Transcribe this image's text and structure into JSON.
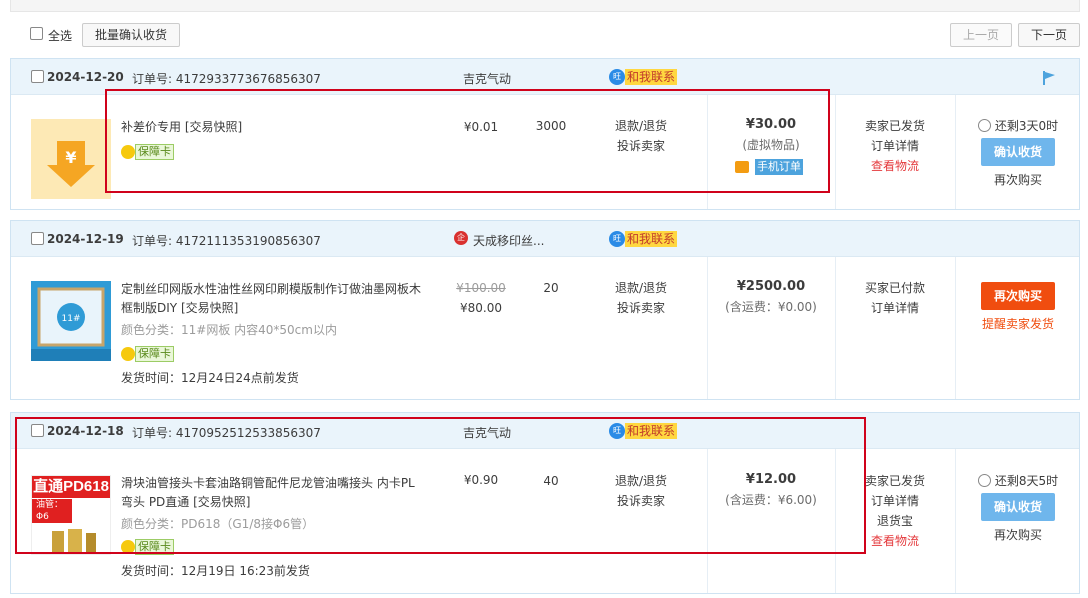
{
  "toolbar": {
    "select_all": "全选",
    "batch_confirm": "批量确认收货",
    "prev_page": "上一页",
    "next_page": "下一页"
  },
  "orders": [
    {
      "date": "2024-12-20",
      "order_no_label": "订单号: 4172933773676856307",
      "shop": "吉克气动",
      "contact": "和我联系",
      "item": {
        "name": "补差价专用",
        "snapshot": "[交易快照]",
        "guarantee": "保障卡",
        "price": "¥0.01",
        "qty": "3000",
        "service_refund": "退款/退货",
        "service_complain": "投诉卖家"
      },
      "total": "¥30.00",
      "total_sub": "(虚拟物品)",
      "mobile_tag": "手机订单",
      "status": [
        "卖家已发货",
        "订单详情",
        "查看物流"
      ],
      "timer": "还剩3天0时",
      "primary_action": "确认收货",
      "secondary_action": "再次购买"
    },
    {
      "date": "2024-12-19",
      "order_no_label": "订单号: 4172111353190856307",
      "shop": "天成移印丝...",
      "contact": "和我联系",
      "item": {
        "name": "定制丝印网版水性油性丝网印刷模版制作订做油墨网板木框制版DIY",
        "snapshot": "[交易快照]",
        "sku": "颜色分类：11#网板 内容40*50cm以内",
        "guarantee": "保障卡",
        "ship_time": "发货时间：12月24日24点前发货",
        "price_old": "¥100.00",
        "price": "¥80.00",
        "qty": "20",
        "service_refund": "退款/退货",
        "service_complain": "投诉卖家"
      },
      "total": "¥2500.00",
      "total_sub": "(含运费：¥0.00)",
      "status": [
        "买家已付款",
        "订单详情"
      ],
      "primary_action": "再次购买",
      "secondary_action": "提醒卖家发货"
    },
    {
      "date": "2024-12-18",
      "order_no_label": "订单号: 4170952512533856307",
      "shop": "吉克气动",
      "contact": "和我联系",
      "item": {
        "name": "滑块油管接头卡套油路铜管配件尼龙管油嘴接头 内卡PL弯头 PD直通",
        "snapshot": "[交易快照]",
        "sku": "颜色分类：PD618（G1/8接Φ6管）",
        "guarantee": "保障卡",
        "ship_time": "发货时间：12月19日 16:23前发货",
        "price": "¥0.90",
        "qty": "40",
        "service_refund": "退款/退货",
        "service_complain": "投诉卖家",
        "thumb_text": "直通PD618",
        "thumb_sub": "油管：Φ6"
      },
      "total": "¥12.00",
      "total_sub": "(含运费：¥6.00)",
      "status": [
        "卖家已发货",
        "订单详情",
        "退货宝",
        "查看物流"
      ],
      "timer": "还剩8天5时",
      "primary_action": "确认收货",
      "secondary_action": "再次购买"
    }
  ],
  "colors": {
    "header_bg": "#eaf4fb",
    "confirm_blue": "#6fb6ec",
    "rebuy_orange": "#f04d0f",
    "highlight_red": "#d0021b"
  }
}
